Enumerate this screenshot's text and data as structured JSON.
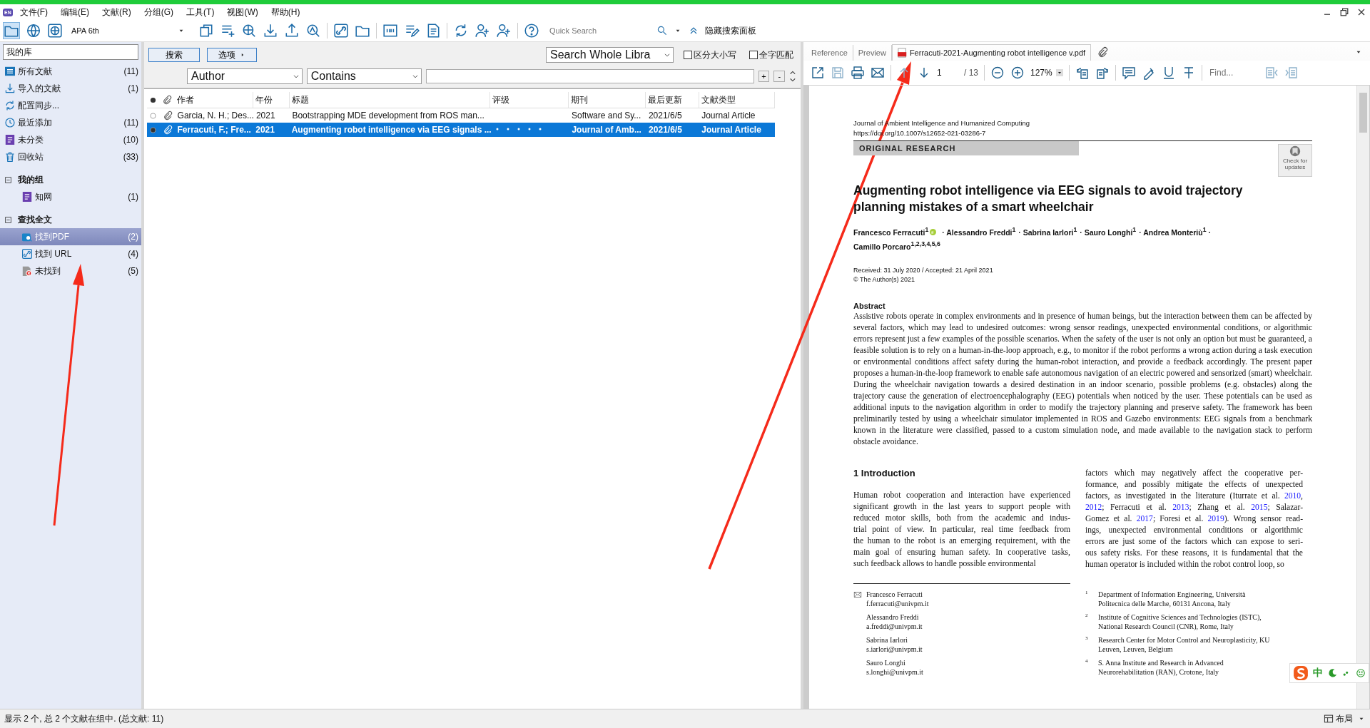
{
  "app": {
    "icon_text": "EN"
  },
  "menu": [
    "文件(F)",
    "编辑(E)",
    "文献(R)",
    "分组(G)",
    "工具(T)",
    "视图(W)",
    "帮助(H)"
  ],
  "toolbar": {
    "style": "APA 6th",
    "quick_search": {
      "placeholder": "Quick Search"
    },
    "hide_search_panel": "隐藏搜索面板"
  },
  "sidebar": {
    "header": "我的库",
    "items": [
      {
        "label": "所有文献",
        "count": "(11)",
        "selected": false
      },
      {
        "label": "导入的文献",
        "count": "(1)",
        "selected": false
      },
      {
        "label": "配置同步...",
        "selected": false
      },
      {
        "label": "最近添加",
        "count": "(11)",
        "selected": false
      },
      {
        "label": "未分类",
        "count": "(10)",
        "selected": false
      },
      {
        "label": "回收站",
        "count": "(33)",
        "selected": false
      }
    ],
    "groups": [
      {
        "label": "我的组",
        "expanded": true,
        "children": [
          {
            "label": "知网",
            "count": "(1)",
            "selected": false
          }
        ]
      },
      {
        "label": "查找全文",
        "expanded": true,
        "children": [
          {
            "label": "找到PDF",
            "count": "(2)",
            "selected": true
          },
          {
            "label": "找到 URL",
            "count": "(4)",
            "selected": false
          },
          {
            "label": "未找到",
            "count": "(5)",
            "selected": false
          }
        ]
      }
    ]
  },
  "search_panel": {
    "search_button": "搜索",
    "options_button": "选项",
    "scope": "Search Whole Libra",
    "options": [
      {
        "label": "区分大小写",
        "checked": false
      },
      {
        "label": "全字匹配",
        "checked": false
      }
    ],
    "field": "Author",
    "operator": "Contains",
    "add": "+",
    "remove": "-"
  },
  "table": {
    "columns": [
      "作者",
      "年份",
      "标题",
      "评级",
      "期刊",
      "最后更新",
      "文献类型"
    ],
    "rows": [
      {
        "unread": false,
        "selected": false,
        "author": "Garcia, N. H.; Des...",
        "year": "2021",
        "title": "Bootstrapping MDE development from ROS man...",
        "journal": "Software and Sy...",
        "updated": "2021/6/5",
        "type": "Journal Article"
      },
      {
        "unread": true,
        "selected": true,
        "author": "Ferracuti, F.; Fre...",
        "year": "2021",
        "title": "Augmenting robot intelligence via EEG signals ...",
        "journal": "Journal of Amb...",
        "updated": "2021/6/5",
        "type": "Journal Article"
      }
    ]
  },
  "viewer": {
    "tabs": [
      {
        "label": "Reference",
        "selected": false,
        "kind": "text"
      },
      {
        "label": "Preview",
        "selected": false,
        "kind": "text"
      },
      {
        "label": "Ferracuti-2021-Augmenting robot intelligence v.pdf",
        "selected": true,
        "kind": "pdf"
      }
    ],
    "page": "1",
    "page_count": "/ 13",
    "zoom": "127%",
    "find_placeholder": "Find..."
  },
  "pdf": {
    "journal": "Journal of Ambient Intelligence and Humanized Computing",
    "doi": "https://doi.org/10.1007/s12652-021-03286-7",
    "section": "ORIGINAL RESEARCH",
    "badge": "Check for updates",
    "title": "Augmenting robot intelligence via EEG signals to avoid trajectory planning mistakes of a smart wheelchair",
    "authors": [
      {
        "name": "Francesco Ferracuti$^{1}$",
        "orcid": true
      },
      {
        "name": "· Alessandro Freddi$^{1}$",
        "orcid": false
      },
      {
        "name": "· Sabrina Iarlori$^{1}$",
        "orcid": false
      },
      {
        "name": "· Sauro Longhi$^{1}$",
        "orcid": false
      },
      {
        "name": "· Andrea Monteriù$^{1}$ ·",
        "orcid": false
      },
      {
        "name": "Camillo Porcaro$^{1,2,3,4,5,6}$",
        "orcid": false
      }
    ],
    "received": "Received: 31 July 2020 / Accepted: 21 April 2021",
    "copyright": "© The Author(s) 2021",
    "abstract_heading": "Abstract",
    "abstract": "Assistive robots operate in complex environments and in presence of human beings, but the interaction between them can be affected by several factors, which may lead to undesired outcomes: wrong sensor readings, unexpected environmental conditions, or algorithmic errors represent just a few examples of the possible scenarios. When the safety of the user is not only an option but must be guaranteed, a feasible solution is to rely on a human-in-the-loop approach, e.g., to monitor if the robot performs a wrong action during a task execution or environmental conditions affect safety during the human-robot interaction, and provide a feedback accordingly. The present paper proposes a human-in-the-loop framework to enable safe autonomous navigation of an electric powered and sensorized (smart) wheelchair. During the wheelchair navigation towards a desired destination in an indoor scenario, possible problems (e.g. obstacles) along the trajectory cause the generation of electroencephalography (EEG) potentials when noticed by the user. These potentials can be used as additional inputs to the navigation algorithm in order to modify the trajectory planning and preserve safety. The framework has been preliminarily tested by using a wheelchair simulator implemented in ROS and Gazebo environments: EEG signals from a benchmark known in the literature were classified, passed to a custom simulation node, and made available to the navigation stack to perform obstacle avoidance.",
    "intro_heading": "1  Introduction",
    "intro_left": [
      "Human robot cooperation and interaction have experienced",
      "significant growth in the last years to support people with",
      "reduced motor skills, both from the academic and indus-",
      "trial point of view. In particular, real time feedback from",
      "the human to the robot is an emerging requirement, with the",
      "main goal of ensuring human safety. In cooperative tasks,",
      "such feedback allows to handle possible environmental"
    ],
    "intro_right": [
      [
        {
          "kind": "text",
          "text": "factors which may negatively affect the cooperative per-"
        }
      ],
      [
        {
          "kind": "text",
          "text": "formance, and possibly mitigate the effects of unexpected"
        }
      ],
      [
        {
          "kind": "text",
          "text": "factors, as investigated in the literature (Iturrate et al. "
        },
        {
          "kind": "link",
          "text": "2010"
        },
        {
          "kind": "text",
          "text": ","
        }
      ],
      [
        {
          "kind": "link",
          "text": "2012"
        },
        {
          "kind": "text",
          "text": "; Ferracuti et al. "
        },
        {
          "kind": "link",
          "text": "2013"
        },
        {
          "kind": "text",
          "text": "; Zhang et al. "
        },
        {
          "kind": "link",
          "text": "2015"
        },
        {
          "kind": "text",
          "text": "; Salazar-"
        }
      ],
      [
        {
          "kind": "text",
          "text": "Gomez et al. "
        },
        {
          "kind": "link",
          "text": "2017"
        },
        {
          "kind": "text",
          "text": "; Foresi et al. "
        },
        {
          "kind": "link",
          "text": "2019"
        },
        {
          "kind": "text",
          "text": "). Wrong sensor read-"
        }
      ],
      [
        {
          "kind": "text",
          "text": "ings, unexpected environmental conditions or algorithmic"
        }
      ],
      [
        {
          "kind": "text",
          "text": "errors are just some of the factors which can expose to seri-"
        }
      ],
      [
        {
          "kind": "text",
          "text": "ous safety risks. For these reasons, it is fundamental that the"
        }
      ],
      [
        {
          "kind": "text",
          "text": "human operator is included within the robot control loop, so"
        }
      ]
    ],
    "contacts": [
      {
        "name": "Francesco Ferracuti",
        "email": "f.ferracuti@univpm.it",
        "corresponding": true
      },
      {
        "name": "Alessandro Freddi",
        "email": "a.freddi@univpm.it",
        "corresponding": false
      },
      {
        "name": "Sabrina Iarlori",
        "email": "s.iarlori@univpm.it",
        "corresponding": false
      },
      {
        "name": "Sauro Longhi",
        "email": "s.longhi@univpm.it",
        "corresponding": false
      }
    ],
    "affiliations": [
      {
        "num": "1",
        "text": "Department of Information Engineering, Università Politecnica delle Marche, 60131 Ancona, Italy"
      },
      {
        "num": "2",
        "text": "Institute of Cognitive Sciences and Technologies (ISTC), National Research Council (CNR), Rome, Italy"
      },
      {
        "num": "3",
        "text": "Research Center for Motor Control and Neuroplasticity, KU Leuven, Leuven, Belgium"
      },
      {
        "num": "4",
        "text": "S. Anna Institute and Research in Advanced Neurorehabilitation (RAN), Crotone, Italy"
      }
    ]
  },
  "ime": {
    "mode": "中"
  },
  "status_bar": {
    "text": "显示 2 个, 总 2 个文献在组中. (总文献: 11)",
    "layout": "布局"
  }
}
